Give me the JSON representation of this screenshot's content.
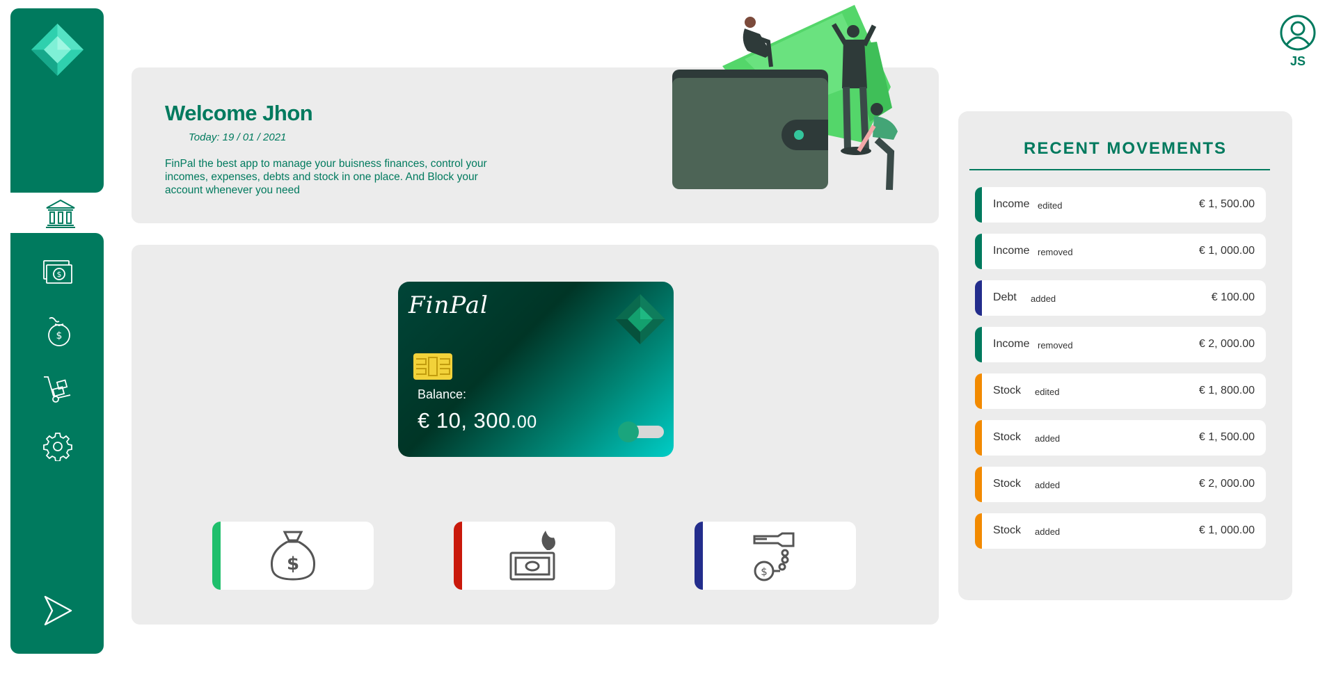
{
  "sidebar": {
    "items": [
      {
        "icon": "bank-icon",
        "active": true
      },
      {
        "icon": "money-bill-icon",
        "active": false
      },
      {
        "icon": "money-bag-icon",
        "active": false
      },
      {
        "icon": "hand-truck-icon",
        "active": false
      },
      {
        "icon": "gear-icon",
        "active": false
      }
    ],
    "bottom_icon": "send-icon"
  },
  "welcome": {
    "title": "Welcome Jhon",
    "date": "Today: 19 / 01 / 2021",
    "description": "FinPal the best app to manage your buisness finances, control your incomes, expenses, debts and stock in one place. And Block your account whenever you need"
  },
  "card": {
    "brand": "FinPal",
    "balance_label": "Balance:",
    "balance_main": "€ 10, 300.",
    "balance_cents": "00",
    "blocked_toggle_on": false
  },
  "actions": [
    {
      "icon": "money-bag-icon",
      "color": "#1fbf6c"
    },
    {
      "icon": "burning-money-icon",
      "color": "#c9190b"
    },
    {
      "icon": "chained-money-icon",
      "color": "#232d8c"
    }
  ],
  "user": {
    "initials": "JS"
  },
  "recent": {
    "title": "RECENT MOVEMENTS",
    "items": [
      {
        "type": "Income",
        "action": "edited",
        "amount": "€ 1, 500.00",
        "color": "#007a5e"
      },
      {
        "type": "Income",
        "action": "removed",
        "amount": "€ 1, 000.00",
        "color": "#007a5e"
      },
      {
        "type": "Debt",
        "action": "added",
        "amount": "€ 100.00",
        "color": "#232d8c"
      },
      {
        "type": "Income",
        "action": "removed",
        "amount": "€ 2, 000.00",
        "color": "#007a5e"
      },
      {
        "type": "Stock",
        "action": "edited",
        "amount": "€ 1, 800.00",
        "color": "#f28a00"
      },
      {
        "type": "Stock",
        "action": "added",
        "amount": "€ 1, 500.00",
        "color": "#f28a00"
      },
      {
        "type": "Stock",
        "action": "added",
        "amount": "€ 2, 000.00",
        "color": "#f28a00"
      },
      {
        "type": "Stock",
        "action": "added",
        "amount": "€ 1, 000.00",
        "color": "#f28a00"
      }
    ]
  },
  "colors": {
    "primary": "#007a5e",
    "panel": "#ececec"
  }
}
